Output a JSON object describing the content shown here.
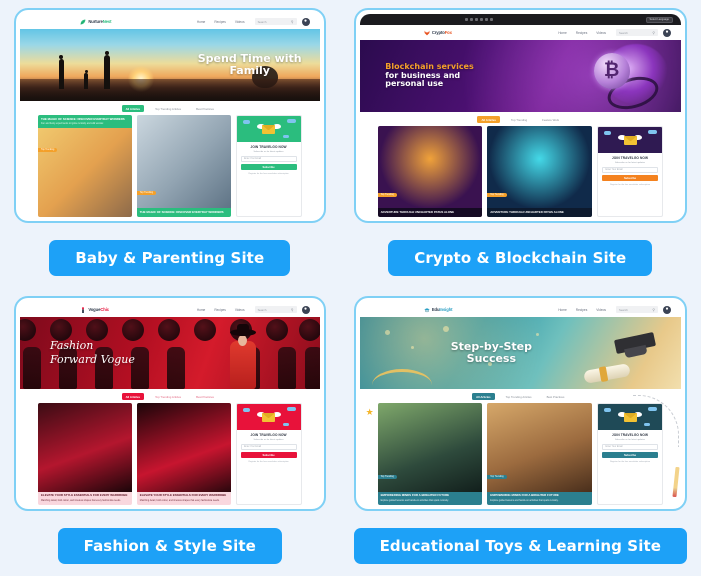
{
  "theme": {
    "page_bg": "#edf3fb",
    "cta_blue": "#1da1f7",
    "card_border": "#7fd0f5"
  },
  "cards": [
    {
      "id": "baby-parenting",
      "cta_label": "Baby & Parenting Site",
      "accent": "#2bbd7e",
      "site": {
        "logo_text_a": "Nurture",
        "logo_text_b": "Nest",
        "logo_icon": "leaf-icon",
        "nav": [
          "Home",
          "Recipes",
          "Videos"
        ],
        "search_placeholder": "Search",
        "search_icon": "search-icon",
        "account_icon": "account-icon"
      },
      "hero": {
        "line1": "Spend Time with",
        "line2": "Family"
      },
      "tabs": [
        "All Articles",
        "Top Trending Articles",
        "Best Practices"
      ],
      "articles": [
        {
          "badge": "Top Trending",
          "title": "THE MAGIC OF SCIENCE: DISCOVER EVERYDAY WONDERS",
          "excerpt": "Fun and lively experiments to ignite curiosity and wild wonder."
        },
        {
          "badge": "Top Trending",
          "title": "THE MAGIC OF SCIENCE: DISCOVER EVERYDAY WONDERS",
          "excerpt": "Fun and lively experiments to ignite curiosity and wild wonder."
        }
      ],
      "newsletter": {
        "heading": "JOIN TRAVELGO NOW",
        "subheading": "Subscribe us for latest updates",
        "input_placeholder": "Enter Your Email",
        "button_label": "Subscribe",
        "footnote": "Register for the free newsletter subscription"
      }
    },
    {
      "id": "crypto-blockchain",
      "cta_label": "Crypto & Blockchain Site",
      "accent": "#f4a02a",
      "browser_bar": {
        "language_selector": "Select Language"
      },
      "site": {
        "logo_text_a": "Crypto",
        "logo_text_b": "Fox",
        "logo_icon": "fox-icon",
        "nav": [
          "Home",
          "Recipes",
          "Videos"
        ],
        "search_placeholder": "Search",
        "search_icon": "search-icon",
        "account_icon": "account-icon"
      },
      "hero": {
        "line1": "Blockchain services",
        "line2": "for business and",
        "line3": "personal use"
      },
      "tabs": [
        "All Articles",
        "Top Trending",
        "Feature Work"
      ],
      "articles": [
        {
          "badge": "Top Trending",
          "title": "ADVENTURE THROUGH UNCHARTED PATHS ALONE",
          "excerpt": "Explore hidden trails and unlock your next journey."
        },
        {
          "badge": "Top Trending",
          "title": "ADVENTURE THROUGH UNCHARTED PATHS ALONE",
          "excerpt": "Explore hidden trails and unlock your next journey."
        }
      ],
      "newsletter": {
        "heading": "JOIN TRAVELGO NOW",
        "subheading": "Subscribe us for latest updates",
        "input_placeholder": "Enter Your Email",
        "button_label": "Subscribe",
        "footnote": "Register for the free newsletter subscription"
      }
    },
    {
      "id": "fashion-style",
      "cta_label": "Fashion & Style Site",
      "accent": "#e8123a",
      "site": {
        "logo_text_a": "Vogue",
        "logo_text_b": "Chic",
        "logo_icon": "lipstick-icon",
        "nav": [
          "Home",
          "Recipes",
          "Videos"
        ],
        "search_placeholder": "Search",
        "search_icon": "search-icon",
        "account_icon": "account-icon"
      },
      "hero": {
        "line1": "Fashion",
        "line2": "Forward Vogue"
      },
      "tabs": [
        "All Articles",
        "Top Trending Articles",
        "Best Practices"
      ],
      "articles": [
        {
          "badge": "",
          "title": "ELEVATE YOUR STYLE ESSENTIALS FOR EVERY WARDROBE",
          "excerpt": "Matching detail, bold colour, and timeless shapes that every fashionista needs."
        },
        {
          "badge": "",
          "title": "ELEVATE YOUR STYLE ESSENTIALS FOR EVERY WARDROBE",
          "excerpt": "Matching detail, bold colour, and timeless shapes that every fashionista needs."
        }
      ],
      "newsletter": {
        "heading": "JOIN TRAVELGO NOW",
        "subheading": "Subscribe us for latest updates",
        "input_placeholder": "Enter Your Email",
        "button_label": "Subscribe",
        "footnote": "Register for the free newsletter subscription"
      }
    },
    {
      "id": "educational-toys",
      "cta_label": "Educational Toys & Learning Site",
      "accent": "#2b7f8f",
      "site": {
        "logo_text_a": "Edu",
        "logo_text_b": "Insight",
        "logo_icon": "graduation-cap-icon",
        "nav": [
          "Home",
          "Recipes",
          "Videos"
        ],
        "search_placeholder": "Search",
        "search_icon": "search-icon",
        "account_icon": "account-icon"
      },
      "hero": {
        "line1": "Step-by-Step",
        "line2": "Success"
      },
      "tabs": [
        "All Articles",
        "Top Trending Articles",
        "Best Practices"
      ],
      "articles": [
        {
          "badge": "Top Trending",
          "title": "EMPOWERING MINDS FOR A BRIGHTER FUTURE",
          "excerpt": "Explore guided lessons and hands-on activities that spark curiosity."
        },
        {
          "badge": "Top Trending",
          "title": "EMPOWERING MINDS FOR A BRIGHTER FUTURE",
          "excerpt": "Explore guided lessons and hands-on activities that spark curiosity."
        }
      ],
      "newsletter": {
        "heading": "JOIN TRAVELGO NOW",
        "subheading": "Subscribe us for latest updates",
        "input_placeholder": "Enter Your Email",
        "button_label": "Subscribe",
        "footnote": "Register for the free newsletter subscription"
      },
      "decorations": [
        "star-icon",
        "pencil-icon",
        "dashed-arc"
      ]
    }
  ]
}
